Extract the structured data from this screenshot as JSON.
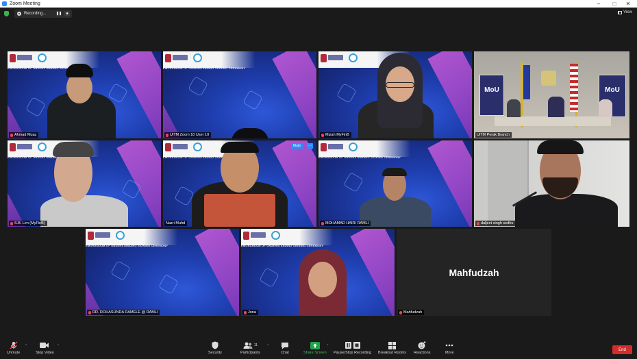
{
  "window": {
    "title": "Zoom Meeting",
    "minimize": "–",
    "maximize": "□",
    "close": "✕"
  },
  "topbar": {
    "recording_label": "Recording...",
    "view_label": "View"
  },
  "tiles": [
    {
      "name": "Ahmad Muaz",
      "headline": "EMORANDUM OF UNDERSTANDING SIGNING CEREMONY"
    },
    {
      "name": "UiTM Zoom 10 User 10",
      "headline": "EMORANDUM OF UNDERSTANDING SIGNING CEREMONY"
    },
    {
      "name": "Mizah MyFinB",
      "headline": ""
    },
    {
      "name": "UiTM Perak Branch",
      "headline": "",
      "sign_left": "MoU",
      "sign_right": "MoU"
    },
    {
      "name": "S.B. Lim (MyFinB)",
      "headline": "EMORANDUM OF UNDERSTANDING SIGNING CEREMONY"
    },
    {
      "name": "Nazri Muhd",
      "headline": "EMORANDUM OF UNDERSTANDING SIGNING CEREMONY",
      "mute_label": "Mute",
      "more_label": "···"
    },
    {
      "name": "MOHAMAD HAIRI RAMLI",
      "headline": "EMORANDUM OF UNDERSTANDING SIGNING CEREMONY"
    },
    {
      "name": "daljeet singh sedhu",
      "headline": ""
    },
    {
      "name": "DR. ROHASUNDA RAMELE @ RAMLI",
      "headline": "EMORANDUM OF UNDERSTANDING SIGNING CEREMONY"
    },
    {
      "name": "Jona",
      "headline": "EMORANDUM OF UNDERSTANDING SIGNING CEREMONY"
    },
    {
      "name": "Mahfudzah",
      "headline": "",
      "display_name": "Mahfudzah"
    }
  ],
  "toolbar": {
    "unmute": "Unmute",
    "stop_video": "Stop Video",
    "security": "Security",
    "participants": "Participants",
    "participants_count": "11",
    "chat": "Chat",
    "share_screen": "Share Screen",
    "pause_stop_recording": "Pause/Stop Recording",
    "breakout_rooms": "Breakout Rooms",
    "reactions": "Reactions",
    "more": "More",
    "end": "End"
  },
  "colors": {
    "accent": "#2d8cff",
    "end": "#d42b2b",
    "active_speaker": "#d8e24a",
    "share": "#23a24d"
  }
}
